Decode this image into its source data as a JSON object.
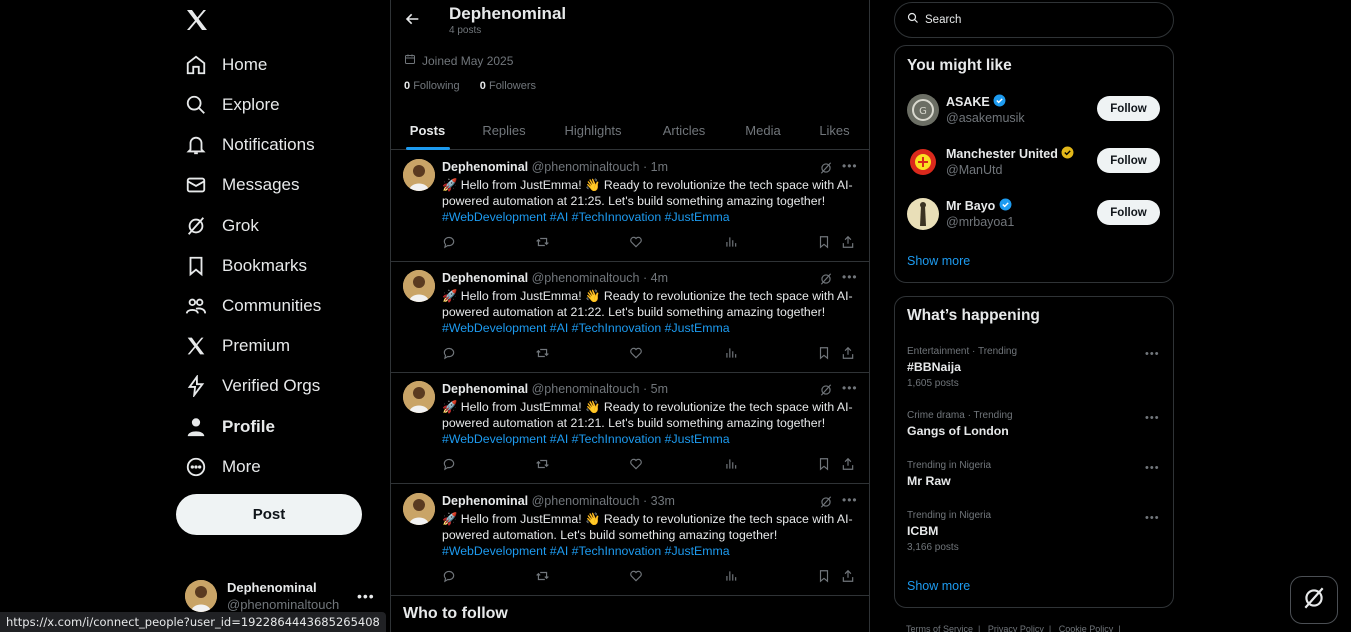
{
  "nav": {
    "items": [
      {
        "label": "Home",
        "icon": "home-icon"
      },
      {
        "label": "Explore",
        "icon": "search-icon"
      },
      {
        "label": "Notifications",
        "icon": "bell-icon"
      },
      {
        "label": "Messages",
        "icon": "mail-icon"
      },
      {
        "label": "Grok",
        "icon": "grok-icon"
      },
      {
        "label": "Bookmarks",
        "icon": "bookmark-icon"
      },
      {
        "label": "Communities",
        "icon": "people-icon"
      },
      {
        "label": "Premium",
        "icon": "x-logo-icon"
      },
      {
        "label": "Verified Orgs",
        "icon": "lightning-icon"
      },
      {
        "label": "Profile",
        "icon": "person-icon"
      },
      {
        "label": "More",
        "icon": "more-circle-icon"
      }
    ],
    "active": "Profile",
    "post_label": "Post"
  },
  "account": {
    "name": "Dephenominal",
    "handle": "@phenominaltouch"
  },
  "status_url": "https://x.com/i/connect_people?user_id=1922864443685265408",
  "profile": {
    "name": "Dephenominal",
    "posts_count": "4 posts",
    "joined": "Joined May 2025",
    "following_count": "0",
    "following_label": "Following",
    "followers_count": "0",
    "followers_label": "Followers"
  },
  "tabs": [
    "Posts",
    "Replies",
    "Highlights",
    "Articles",
    "Media",
    "Likes"
  ],
  "active_tab": "Posts",
  "tweets": [
    {
      "name": "Dephenominal",
      "meta": "@phenominaltouch · 1m",
      "text": "🚀 Hello from JustEmma! 👋 Ready to revolutionize the tech space with AI-powered automation at 21:25. Let's build something amazing together!",
      "tags": "#WebDevelopment #AI #TechInnovation #JustEmma"
    },
    {
      "name": "Dephenominal",
      "meta": "@phenominaltouch · 4m",
      "text": "🚀 Hello from JustEmma! 👋 Ready to revolutionize the tech space with AI-powered automation at 21:22. Let's build something amazing together!",
      "tags": "#WebDevelopment #AI #TechInnovation #JustEmma"
    },
    {
      "name": "Dephenominal",
      "meta": "@phenominaltouch · 5m",
      "text": "🚀 Hello from JustEmma! 👋 Ready to revolutionize the tech space with AI-powered automation at 21:21. Let's build something amazing together!",
      "tags": "#WebDevelopment #AI #TechInnovation #JustEmma"
    },
    {
      "name": "Dephenominal",
      "meta": "@phenominaltouch · 33m",
      "text": "🚀 Hello from JustEmma! 👋 Ready to revolutionize the tech space with AI-powered automation. Let's build something amazing together!",
      "tags": "#WebDevelopment #AI #TechInnovation #JustEmma"
    }
  ],
  "who_to_follow": "Who to follow",
  "search": {
    "placeholder": "Search"
  },
  "you_might_like": {
    "title": "You might like",
    "accounts": [
      {
        "name": "ASAKE",
        "handle": "@asakemusik",
        "verified": "blue",
        "follow_label": "Follow"
      },
      {
        "name": "Manchester United",
        "handle": "@ManUtd",
        "verified": "gold",
        "follow_label": "Follow"
      },
      {
        "name": "Mr Bayo",
        "handle": "@mrbayoa1",
        "verified": "blue",
        "follow_label": "Follow"
      }
    ],
    "show_more": "Show more"
  },
  "whats_happening": {
    "title": "What’s happening",
    "trends": [
      {
        "context": "Entertainment · Trending",
        "title": "#BBNaija",
        "count": "1,605 posts"
      },
      {
        "context": "Crime drama · Trending",
        "title": "Gangs of London",
        "count": ""
      },
      {
        "context": "Trending in Nigeria",
        "title": "Mr Raw",
        "count": ""
      },
      {
        "context": "Trending in Nigeria",
        "title": "ICBM",
        "count": "3,166 posts"
      }
    ],
    "show_more": "Show more"
  },
  "footer": [
    "Terms of Service",
    "Privacy Policy",
    "Cookie Policy"
  ],
  "colors": {
    "accent": "#1d9bf0",
    "background": "#000000",
    "border": "#2f3336",
    "muted": "#71767b"
  }
}
